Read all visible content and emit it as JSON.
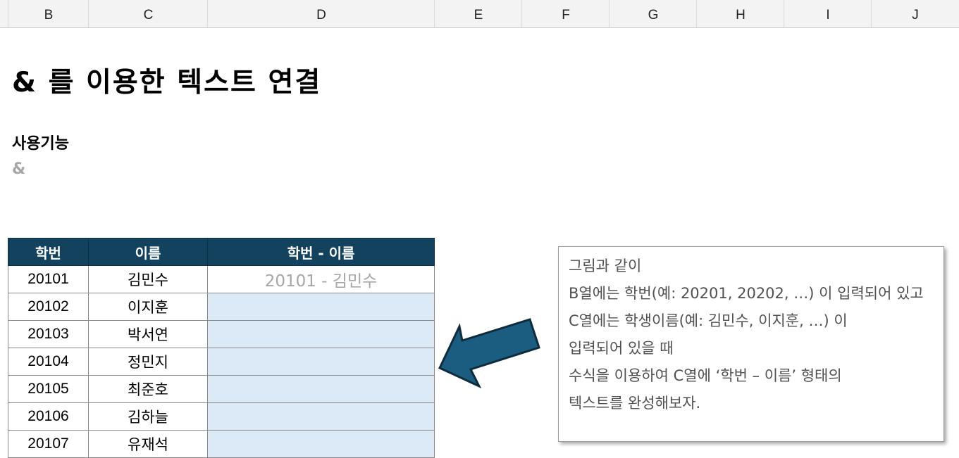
{
  "column_headers": [
    "B",
    "C",
    "D",
    "E",
    "F",
    "G",
    "H",
    "I",
    "J"
  ],
  "title": "& 를 이용한 텍스트 연결",
  "feature_label": "사용기능",
  "feature_value": "&",
  "table": {
    "headers": [
      "학번",
      "이름",
      "학번 - 이름"
    ],
    "rows": [
      {
        "id": "20101",
        "name": "김민수",
        "result": "20101 - 김민수"
      },
      {
        "id": "20102",
        "name": "이지훈",
        "result": ""
      },
      {
        "id": "20103",
        "name": "박서연",
        "result": ""
      },
      {
        "id": "20104",
        "name": "정민지",
        "result": ""
      },
      {
        "id": "20105",
        "name": "최준호",
        "result": ""
      },
      {
        "id": "20106",
        "name": "김하늘",
        "result": ""
      },
      {
        "id": "20107",
        "name": "유재석",
        "result": ""
      }
    ]
  },
  "note_lines": [
    "그림과 같이",
    "B열에는 학번(예: 20201, 20202, …) 이 입력되어 있고",
    "C열에는 학생이름(예: 김민수, 이지훈, …) 이",
    "입력되어 있을 때",
    "수식을 이용하여 C열에 ‘학번 – 이름’ 형태의",
    "텍스트를 완성해보자."
  ],
  "colors": {
    "header_bg": "#12425d",
    "input_cell_bg": "#dce9f6",
    "arrow_fill": "#1a5d80",
    "arrow_stroke": "#0f2b3c"
  },
  "icons": {
    "arrow": "left-arrow-icon"
  }
}
